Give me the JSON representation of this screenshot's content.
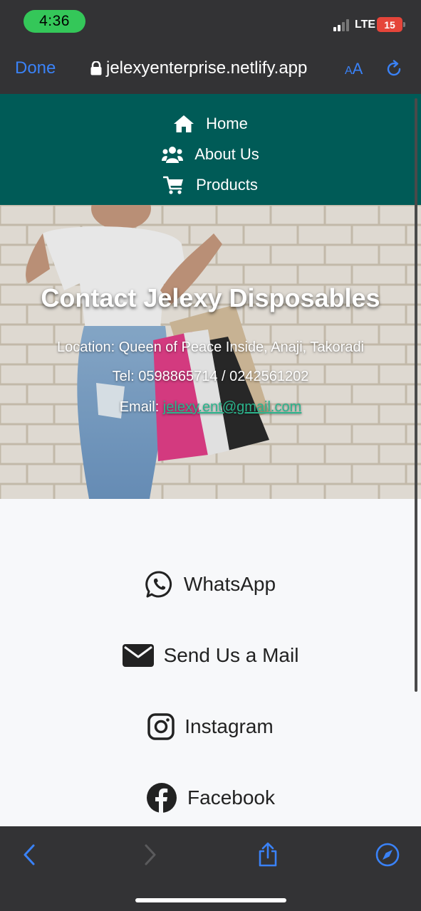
{
  "status_bar": {
    "time": "4:36",
    "network": "LTE",
    "battery": "15"
  },
  "browser": {
    "done_label": "Done",
    "url": "jelexyenterprise.netlify.app",
    "text_size_label_small": "A",
    "text_size_label_large": "A"
  },
  "nav": {
    "items": [
      {
        "label": "Home",
        "icon": "home-icon"
      },
      {
        "label": "About Us",
        "icon": "users-icon"
      },
      {
        "label": "Products",
        "icon": "cart-icon"
      }
    ]
  },
  "hero": {
    "title": "Contact Jelexy Disposables",
    "location": "Location: Queen of Peace Inside, Anaji, Takoradi",
    "tel": "Tel: 0598865714 / 0242561202",
    "email_prefix": "Email: ",
    "email": "jelexy.ent@gmail.com"
  },
  "contact": {
    "items": [
      {
        "label": "WhatsApp",
        "icon": "whatsapp-icon"
      },
      {
        "label": "Send Us a Mail",
        "icon": "envelope-icon"
      },
      {
        "label": "Instagram",
        "icon": "instagram-icon"
      },
      {
        "label": "Facebook",
        "icon": "facebook-icon"
      }
    ]
  },
  "colors": {
    "nav_background": "#005b57",
    "browser_chrome": "#333335",
    "ios_blue": "#3a82f7",
    "status_green": "#34c759",
    "link": "#2bb58d"
  }
}
